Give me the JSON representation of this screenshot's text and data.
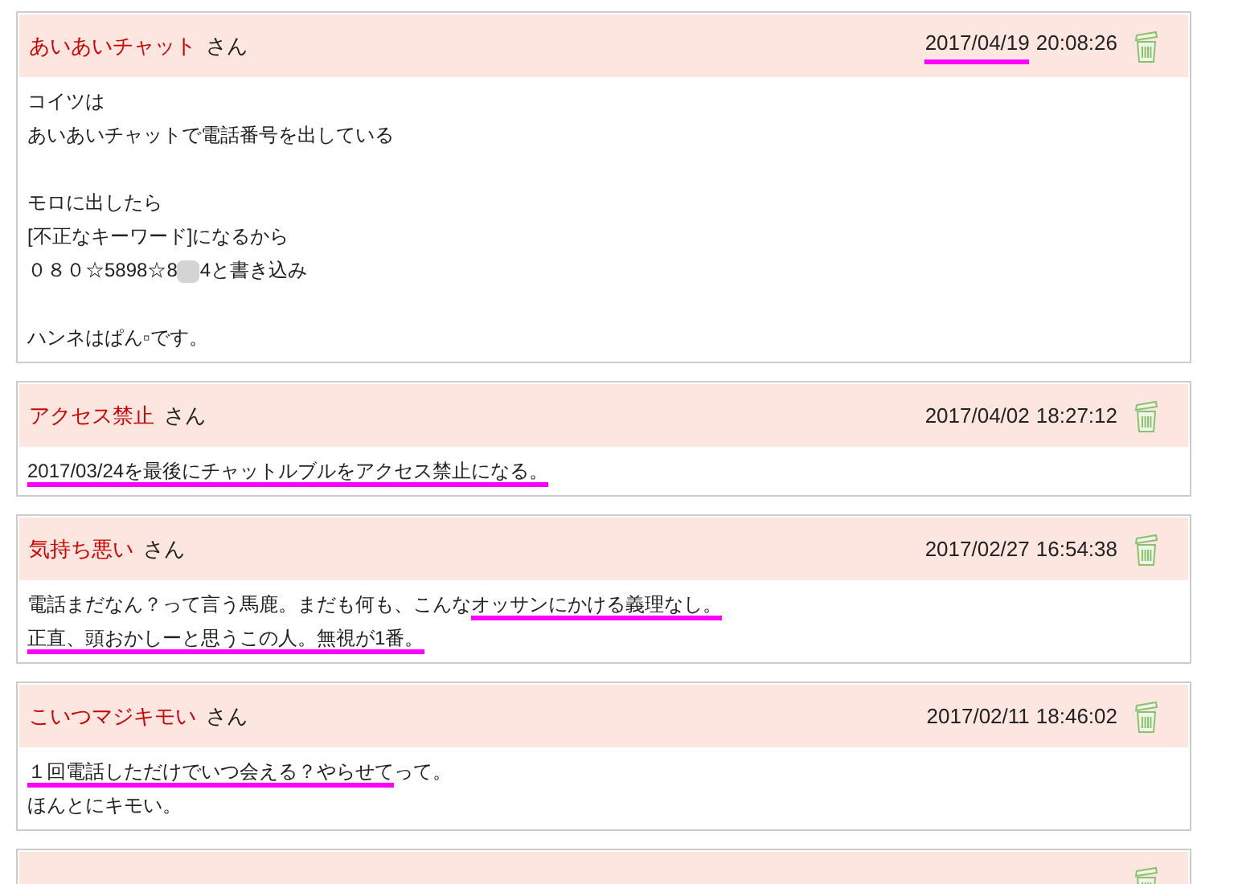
{
  "posts": [
    {
      "name": "あいあいチャット",
      "suffix": "さん",
      "date": "2017/04/19",
      "time": "20:08:26",
      "date_marked": true,
      "lines": [
        [
          {
            "text": "コイツは",
            "marked": false
          }
        ],
        [
          {
            "text": "あいあいチャットで電話番号を出している",
            "marked": false
          }
        ],
        {
          "kind": "gap"
        },
        [
          {
            "text": "モロに出したら",
            "marked": false
          }
        ],
        [
          {
            "text": "[不正なキーワード]になるから",
            "marked": false
          }
        ],
        [
          {
            "text": "０８０☆5898☆8",
            "marked": false
          },
          {
            "kind": "blur"
          },
          {
            "text": "4と書き込み",
            "marked": false
          }
        ],
        {
          "kind": "gap"
        },
        [
          {
            "text": "ハンネはぱん▫です。",
            "marked": false
          }
        ]
      ]
    },
    {
      "name": "アクセス禁止",
      "suffix": "さん",
      "date": "2017/04/02",
      "time": "18:27:12",
      "date_marked": false,
      "lines": [
        [
          {
            "text": "2017/03/24を最後にチャットルブルをアクセス禁止になる。",
            "marked": true
          }
        ]
      ]
    },
    {
      "name": "気持ち悪い",
      "suffix": "さん",
      "date": "2017/02/27",
      "time": "16:54:38",
      "date_marked": false,
      "lines": [
        [
          {
            "text": "電話まだなん？って言う馬鹿。まだも何も、こんな",
            "marked": false
          },
          {
            "text": "オッサンにかける義理なし。",
            "marked": true
          }
        ],
        [
          {
            "text": "正直、頭おかしーと思うこの人。無視が1番。",
            "marked": true
          }
        ]
      ]
    },
    {
      "name": "こいつマジキモい",
      "suffix": "さん",
      "date": "2017/02/11",
      "time": "18:46:02",
      "date_marked": false,
      "lines": [
        [
          {
            "text": "１回電話しただけでいつ会える？やらせて",
            "marked": true
          },
          {
            "text": "って。",
            "marked": false
          }
        ],
        [
          {
            "text": "ほんとにキモい。",
            "marked": false
          }
        ]
      ]
    }
  ],
  "more_below": true
}
